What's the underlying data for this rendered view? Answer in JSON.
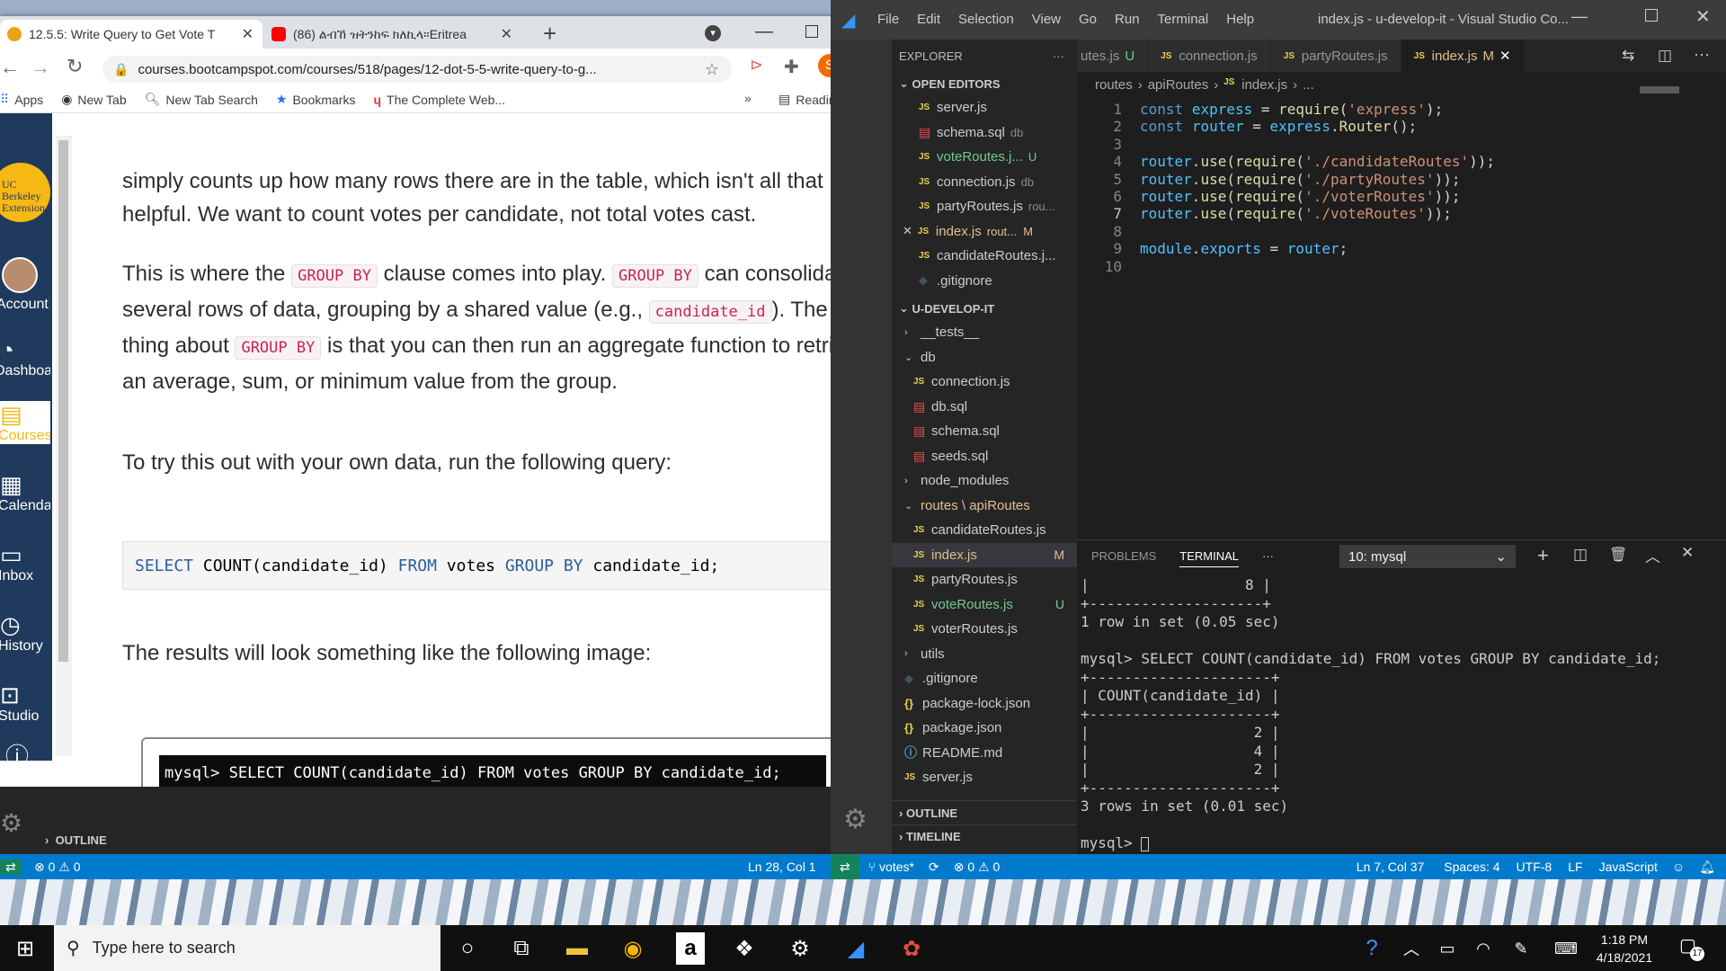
{
  "chrome": {
    "tabs": [
      {
        "title": "12.5.5: Write Query to Get Vote T",
        "active": true
      },
      {
        "title": "(86) ልብኸ ዝትንከፍ ክለኪላ።Eritrea",
        "active": false
      }
    ],
    "new_tab": "+",
    "url": "courses.bootcampspot.com/courses/518/pages/12-dot-5-5-write-query-to-g...",
    "profile": "S",
    "bookmarks": [
      "Apps",
      "New Tab",
      "New Tab Search",
      "Bookmarks",
      "The Complete Web..."
    ],
    "more_bookmarks": "»",
    "reading_list": "Reading list",
    "nav": [
      {
        "label": "UC Berkeley Extension",
        "icon": "logo"
      },
      {
        "label": "Account",
        "icon": "avatar"
      },
      {
        "label": "Dashboard",
        "icon": "dashboard-icon"
      },
      {
        "label": "Courses",
        "icon": "courses-icon"
      },
      {
        "label": "Calendar",
        "icon": "calendar-icon"
      },
      {
        "label": "Inbox",
        "icon": "inbox-icon"
      },
      {
        "label": "History",
        "icon": "history-icon"
      },
      {
        "label": "Studio",
        "icon": "studio-icon"
      },
      {
        "label": "Help",
        "icon": "help-icon"
      }
    ],
    "article": {
      "p1": "simply counts up how many rows there are in the table, which isn't all that helpful. We want to count votes per candidate, not total votes cast.",
      "p2_a": "This is where the",
      "p2_code1": "GROUP BY",
      "p2_b": "clause comes into play.",
      "p2_code2": "GROUP BY",
      "p2_c": "can consolidate several rows of data, grouping by a shared value (e.g.,",
      "p2_code3": "candidate_id",
      "p2_d": "). The nice thing about",
      "p2_code4": "GROUP BY",
      "p2_e": "is that you can then run an aggregate function to retrieve an average, sum, or minimum value from the group.",
      "p3": "To try this out with your own data, run the following query:",
      "code": [
        "SELECT",
        " COUNT(candidate_id) ",
        "FROM",
        " votes ",
        "GROUP BY",
        " candidate_id;"
      ],
      "p4": "The results will look something like the following image:",
      "image_line": "mysql> SELECT COUNT(candidate_id) FROM votes GROUP BY candidate_id;"
    }
  },
  "vscode_left": {
    "outline": "OUTLINE",
    "status_errors": "0",
    "status_warnings": "0",
    "status_position": "Ln 28, Col 1"
  },
  "vscode": {
    "menu": [
      "File",
      "Edit",
      "Selection",
      "View",
      "Go",
      "Run",
      "Terminal",
      "Help"
    ],
    "title": "index.js - u-develop-it - Visual Studio Co...",
    "explorer": "EXPLORER",
    "open_editors_header": "OPEN EDITORS",
    "open_editors": [
      {
        "name": "server.js",
        "type": "js",
        "tag": ""
      },
      {
        "name": "schema.sql",
        "type": "db",
        "tag": "db"
      },
      {
        "name": "voteRoutes.j...",
        "type": "js",
        "tag": "U",
        "color": "#73c991"
      },
      {
        "name": "connection.js",
        "type": "js",
        "tag": "db"
      },
      {
        "name": "partyRoutes.js",
        "type": "js",
        "tag": "rou..."
      },
      {
        "name": "index.js",
        "type": "js",
        "tag": "rout...  M",
        "color": "#e2c08d"
      },
      {
        "name": "candidateRoutes.j...",
        "type": "js",
        "tag": ""
      },
      {
        "name": ".gitignore",
        "type": "git",
        "tag": ""
      }
    ],
    "project_header": "U-DEVELOP-IT",
    "tree": [
      {
        "name": "__tests__",
        "type": "folder",
        "depth": 1
      },
      {
        "name": "db",
        "type": "folder-open",
        "depth": 1
      },
      {
        "name": "connection.js",
        "type": "js",
        "depth": 2
      },
      {
        "name": "db.sql",
        "type": "db",
        "depth": 2
      },
      {
        "name": "schema.sql",
        "type": "db",
        "depth": 2
      },
      {
        "name": "seeds.sql",
        "type": "db",
        "depth": 2
      },
      {
        "name": "node_modules",
        "type": "folder",
        "depth": 1
      },
      {
        "name": "routes \\ apiRoutes",
        "type": "folder-open",
        "depth": 1,
        "color": "#e2c08d"
      },
      {
        "name": "candidateRoutes.js",
        "type": "js",
        "depth": 2
      },
      {
        "name": "index.js",
        "type": "js",
        "depth": 2,
        "tag": "M",
        "color": "#e2c08d"
      },
      {
        "name": "partyRoutes.js",
        "type": "js",
        "depth": 2
      },
      {
        "name": "voteRoutes.js",
        "type": "js",
        "depth": 2,
        "tag": "U",
        "color": "#73c991"
      },
      {
        "name": "voterRoutes.js",
        "type": "js",
        "depth": 2
      },
      {
        "name": "utils",
        "type": "folder",
        "depth": 1
      },
      {
        "name": ".gitignore",
        "type": "git",
        "depth": 1
      },
      {
        "name": "package-lock.json",
        "type": "json",
        "depth": 1
      },
      {
        "name": "package.json",
        "type": "json",
        "depth": 1
      },
      {
        "name": "README.md",
        "type": "info",
        "depth": 1
      },
      {
        "name": "server.js",
        "type": "js",
        "depth": 1
      }
    ],
    "outline": "OUTLINE",
    "timeline": "TIMELINE",
    "tabs": [
      {
        "name": "utes.js",
        "tag": "U"
      },
      {
        "name": "connection.js",
        "tag": ""
      },
      {
        "name": "partyRoutes.js",
        "tag": ""
      },
      {
        "name": "index.js",
        "tag": "M",
        "active": true
      }
    ],
    "breadcrumb": [
      "routes",
      "apiRoutes",
      "index.js",
      "..."
    ],
    "code_lines": [
      "const express = require('express');",
      "const router = express.Router();",
      "",
      "router.use(require('./candidateRoutes'));",
      "router.use(require('./partyRoutes'));",
      "router.use(require('./voterRoutes'));",
      "router.use(require('./voteRoutes'));",
      "",
      "module.exports = router;",
      ""
    ],
    "panel_tabs": [
      "PROBLEMS",
      "TERMINAL"
    ],
    "terminal_select": "10: mysql",
    "terminal_lines": [
      "|                  8 |",
      "+--------------------+",
      "1 row in set (0.05 sec)",
      "",
      "mysql> SELECT COUNT(candidate_id) FROM votes GROUP BY candidate_id;",
      "+---------------------+",
      "| COUNT(candidate_id) |",
      "+---------------------+",
      "|                   2 |",
      "|                   4 |",
      "|                   2 |",
      "+---------------------+",
      "3 rows in set (0.01 sec)",
      "",
      "mysql> "
    ],
    "status": {
      "branch": "votes*",
      "errors": "0",
      "warnings": "0",
      "position": "Ln 7, Col 37",
      "spaces": "Spaces: 4",
      "encoding": "UTF-8",
      "eol": "LF",
      "language": "JavaScript"
    }
  },
  "taskbar": {
    "search_placeholder": "Type here to search",
    "time": "1:18 PM",
    "date": "4/18/2021",
    "notifications": "17"
  },
  "colors": {
    "vscode_status": "#007acc",
    "chrome_tabstrip": "#dee1e6",
    "canvas_nav": "#1f3a5c"
  }
}
